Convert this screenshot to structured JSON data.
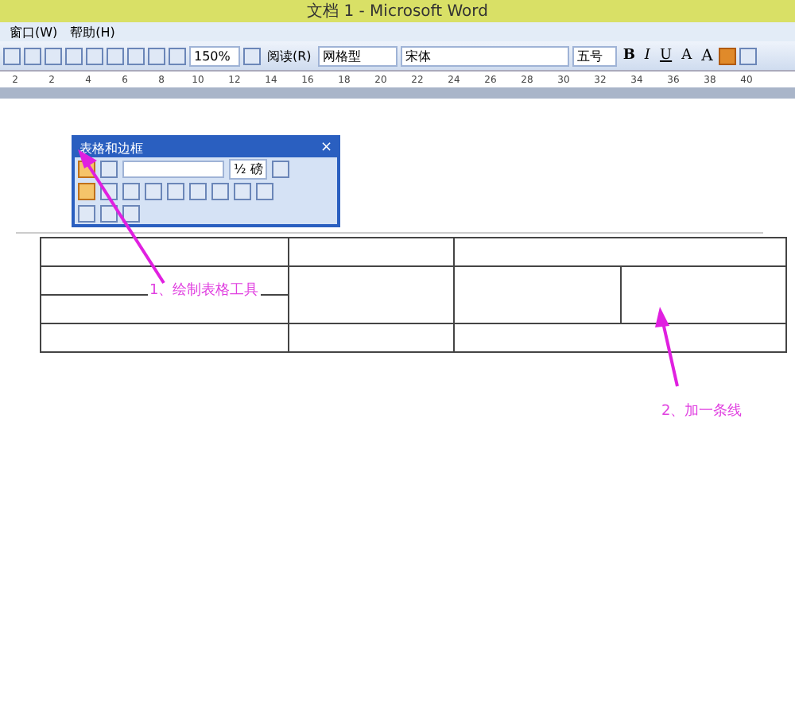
{
  "window": {
    "title": "文档 1 - Microsoft Word"
  },
  "menu": [
    "窗口(W)",
    "帮助(H)"
  ],
  "toolbar": {
    "zoom": "150%",
    "read": "阅读(R)",
    "style": "网格型",
    "font": "宋体",
    "size": "五号",
    "format": [
      "B",
      "I",
      "U",
      "A",
      "A"
    ]
  },
  "ruler": [
    "2",
    "2",
    "4",
    "6",
    "8",
    "10",
    "12",
    "14",
    "16",
    "18",
    "20",
    "22",
    "24",
    "26",
    "28",
    "30",
    "32",
    "34",
    "36",
    "38",
    "40"
  ],
  "floating_toolbar": {
    "title": "表格和边框",
    "line_weight": "½ 磅",
    "close": "×"
  },
  "annotations": [
    {
      "text": "1、绘制表格工具"
    },
    {
      "text": "2、加一条线"
    }
  ]
}
